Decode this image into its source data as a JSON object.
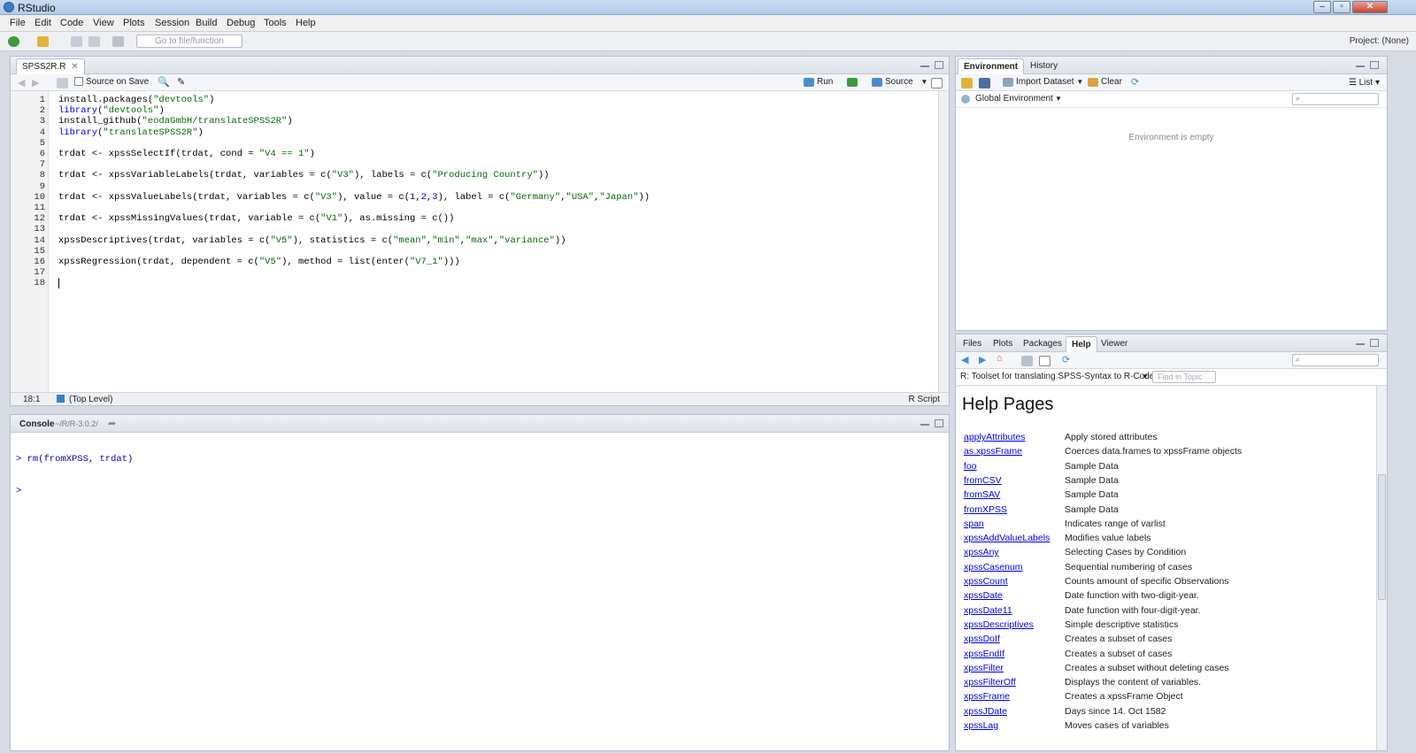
{
  "window": {
    "title": "RStudio"
  },
  "menu": [
    "File",
    "Edit",
    "Code",
    "View",
    "Plots",
    "Session",
    "Build",
    "Debug",
    "Tools",
    "Help"
  ],
  "toolbar": {
    "goto_placeholder": "Go to file/function",
    "project": "Project: (None)"
  },
  "editor": {
    "tab": "SPSS2R.R",
    "source_on_save": "Source on Save",
    "run": "Run",
    "source": "Source",
    "status_pos": "18:1",
    "status_scope": "(Top Level)",
    "status_type": "R Script",
    "lines": [
      {
        "n": "1",
        "html": "install.packages(<span class=\"str\">\"devtools\"</span>)"
      },
      {
        "n": "2",
        "html": "<span class=\"kw\">library</span>(<span class=\"str\">\"devtools\"</span>)"
      },
      {
        "n": "3",
        "html": "install_github(<span class=\"str\">\"eodaGmbH/translateSPSS2R\"</span>)"
      },
      {
        "n": "4",
        "html": "<span class=\"kw\">library</span>(<span class=\"str\">\"translateSPSS2R\"</span>)"
      },
      {
        "n": "5",
        "html": ""
      },
      {
        "n": "6",
        "html": "trdat &lt;- xpssSelectIf(trdat, cond = <span class=\"str\">\"V4 == 1\"</span>)"
      },
      {
        "n": "7",
        "html": ""
      },
      {
        "n": "8",
        "html": "trdat &lt;- xpssVariableLabels(trdat, variables = c(<span class=\"str\">\"V3\"</span>), labels = c(<span class=\"str\">\"Producing Country\"</span>))"
      },
      {
        "n": "9",
        "html": ""
      },
      {
        "n": "10",
        "html": "trdat &lt;- xpssValueLabels(trdat, variables = c(<span class=\"str\">\"V3\"</span>), value = c(<span class=\"num\">1</span>,<span class=\"num\">2</span>,<span class=\"num\">3</span>), label = c(<span class=\"str\">\"Germany\"</span>,<span class=\"str\">\"USA\"</span>,<span class=\"str\">\"Japan\"</span>))"
      },
      {
        "n": "11",
        "html": ""
      },
      {
        "n": "12",
        "html": "trdat &lt;- xpssMissingValues(trdat, variable = c(<span class=\"str\">\"V1\"</span>), as.missing = c())"
      },
      {
        "n": "13",
        "html": ""
      },
      {
        "n": "14",
        "html": "xpssDescriptives(trdat, variables = c(<span class=\"str\">\"V5\"</span>), statistics = c(<span class=\"str\">\"mean\"</span>,<span class=\"str\">\"min\"</span>,<span class=\"str\">\"max\"</span>,<span class=\"str\">\"variance\"</span>))"
      },
      {
        "n": "15",
        "html": ""
      },
      {
        "n": "16",
        "html": "xpssRegression(trdat, dependent = c(<span class=\"str\">\"V5\"</span>), method = list(enter(<span class=\"str\">\"V7_1\"</span>)))"
      },
      {
        "n": "17",
        "html": ""
      },
      {
        "n": "18",
        "html": ""
      }
    ]
  },
  "console": {
    "title": "Console",
    "path": "~/R/R-3.0.2/",
    "lines": [
      "> rm(fromXPSS, trdat)",
      "> "
    ]
  },
  "environment": {
    "tabs": [
      "Environment",
      "History"
    ],
    "import": "Import Dataset",
    "clear": "Clear",
    "list": "List",
    "scope": "Global Environment",
    "empty": "Environment is empty"
  },
  "files_pane": {
    "tabs": [
      "Files",
      "Plots",
      "Packages",
      "Help",
      "Viewer"
    ],
    "topic": "R: Toolset for translating SPSS-Syntax to R-Code",
    "find_placeholder": "Find in Topic",
    "heading": "Help Pages",
    "entries": [
      {
        "name": "applyAttributes",
        "desc": "Apply stored attributes"
      },
      {
        "name": "as.xpssFrame",
        "desc": "Coerces data.frames to xpssFrame objects"
      },
      {
        "name": "foo",
        "desc": "Sample Data"
      },
      {
        "name": "fromCSV",
        "desc": "Sample Data"
      },
      {
        "name": "fromSAV",
        "desc": "Sample Data"
      },
      {
        "name": "fromXPSS",
        "desc": "Sample Data"
      },
      {
        "name": "span",
        "desc": "Indicates range of varlist"
      },
      {
        "name": "xpssAddValueLabels",
        "desc": "Modifies value labels"
      },
      {
        "name": "xpssAny",
        "desc": "Selecting Cases by Condition"
      },
      {
        "name": "xpssCasenum",
        "desc": "Sequential numbering of cases"
      },
      {
        "name": "xpssCount",
        "desc": "Counts amount of specific Observations"
      },
      {
        "name": "xpssDate",
        "desc": "Date function with two-digit-year."
      },
      {
        "name": "xpssDate11",
        "desc": "Date function with four-digit-year."
      },
      {
        "name": "xpssDescriptives",
        "desc": "Simple descriptive statistics"
      },
      {
        "name": "xpssDoIf",
        "desc": "Creates a subset of cases"
      },
      {
        "name": "xpssEndIf",
        "desc": "Creates a subset of cases"
      },
      {
        "name": "xpssFilter",
        "desc": "Creates a subset without deleting cases"
      },
      {
        "name": "xpssFilterOff",
        "desc": "Displays the content of variables."
      },
      {
        "name": "xpssFrame",
        "desc": "Creates a xpssFrame Object"
      },
      {
        "name": "xpssJDate",
        "desc": "Days since 14. Oct 1582"
      },
      {
        "name": "xpssLag",
        "desc": "Moves cases of variables"
      }
    ]
  },
  "colors": {
    "keyword": "#0000ff",
    "string": "#036a07",
    "link": "#0000ee"
  }
}
